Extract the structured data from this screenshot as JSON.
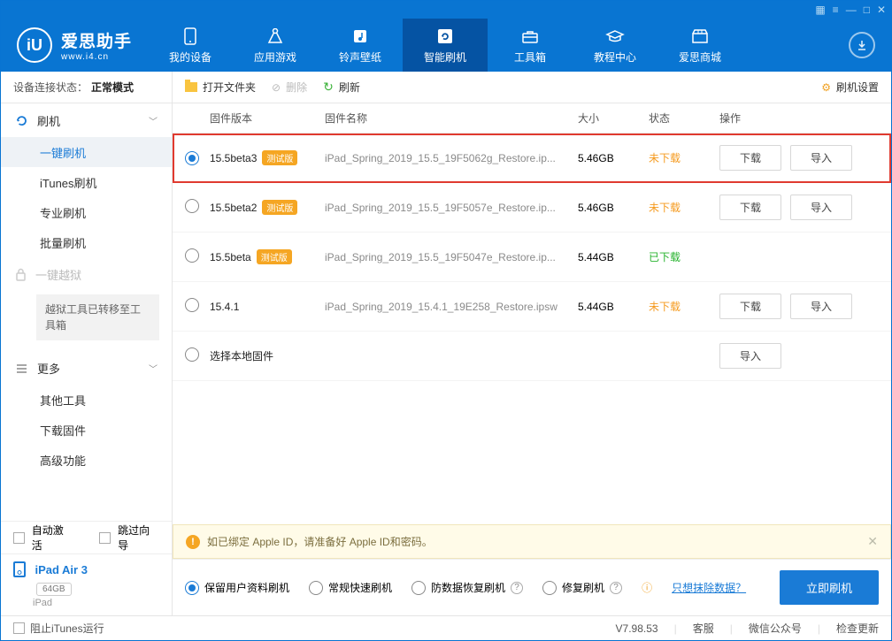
{
  "app": {
    "name": "爱思助手",
    "url": "www.i4.cn",
    "version_label": "V7.98.53"
  },
  "nav": [
    {
      "label": "我的设备"
    },
    {
      "label": "应用游戏"
    },
    {
      "label": "铃声壁纸"
    },
    {
      "label": "智能刷机"
    },
    {
      "label": "工具箱"
    },
    {
      "label": "教程中心"
    },
    {
      "label": "爱思商城"
    }
  ],
  "connection": {
    "label": "设备连接状态：",
    "mode": "正常模式"
  },
  "sidebar": {
    "flash": {
      "title": "刷机",
      "items": [
        "一键刷机",
        "iTunes刷机",
        "专业刷机",
        "批量刷机"
      ]
    },
    "jailbreak": {
      "title": "一键越狱",
      "note": "越狱工具已转移至工具箱"
    },
    "more": {
      "title": "更多",
      "items": [
        "其他工具",
        "下载固件",
        "高级功能"
      ]
    },
    "auto_activate": "自动激活",
    "skip_guide": "跳过向导"
  },
  "device": {
    "name": "iPad Air 3",
    "storage": "64GB",
    "type": "iPad"
  },
  "toolbar": {
    "open_folder": "打开文件夹",
    "delete": "删除",
    "refresh": "刷新",
    "settings": "刷机设置"
  },
  "table": {
    "headers": {
      "version": "固件版本",
      "name": "固件名称",
      "size": "大小",
      "status": "状态",
      "ops": "操作"
    },
    "rows": [
      {
        "version": "15.5beta3",
        "tag": "测试版",
        "name": "iPad_Spring_2019_15.5_19F5062g_Restore.ip...",
        "size": "5.46GB",
        "status": "未下载",
        "status_class": "st-und",
        "selected": true,
        "download": true,
        "import": true,
        "highlight": true
      },
      {
        "version": "15.5beta2",
        "tag": "测试版",
        "name": "iPad_Spring_2019_15.5_19F5057e_Restore.ip...",
        "size": "5.46GB",
        "status": "未下载",
        "status_class": "st-und",
        "selected": false,
        "download": true,
        "import": true
      },
      {
        "version": "15.5beta",
        "tag": "测试版",
        "name": "iPad_Spring_2019_15.5_19F5047e_Restore.ip...",
        "size": "5.44GB",
        "status": "已下载",
        "status_class": "st-done",
        "selected": false,
        "download": false,
        "import": false
      },
      {
        "version": "15.4.1",
        "tag": "",
        "name": "iPad_Spring_2019_15.4.1_19E258_Restore.ipsw",
        "size": "5.44GB",
        "status": "未下载",
        "status_class": "st-und",
        "selected": false,
        "download": true,
        "import": true
      },
      {
        "version": "选择本地固件",
        "tag": "",
        "name": "",
        "size": "",
        "status": "",
        "status_class": "",
        "selected": false,
        "download": false,
        "import": true
      }
    ],
    "btn_download": "下载",
    "btn_import": "导入"
  },
  "notice": "如已绑定 Apple ID，请准备好 Apple ID和密码。",
  "flash_opts": {
    "keep_data": "保留用户资料刷机",
    "normal": "常规快速刷机",
    "anti_loss": "防数据恢复刷机",
    "repair": "修复刷机",
    "erase_link": "只想抹除数据？",
    "flash_btn": "立即刷机"
  },
  "statusbar": {
    "block_itunes": "阻止iTunes运行",
    "support": "客服",
    "wechat": "微信公众号",
    "check_update": "检查更新"
  }
}
